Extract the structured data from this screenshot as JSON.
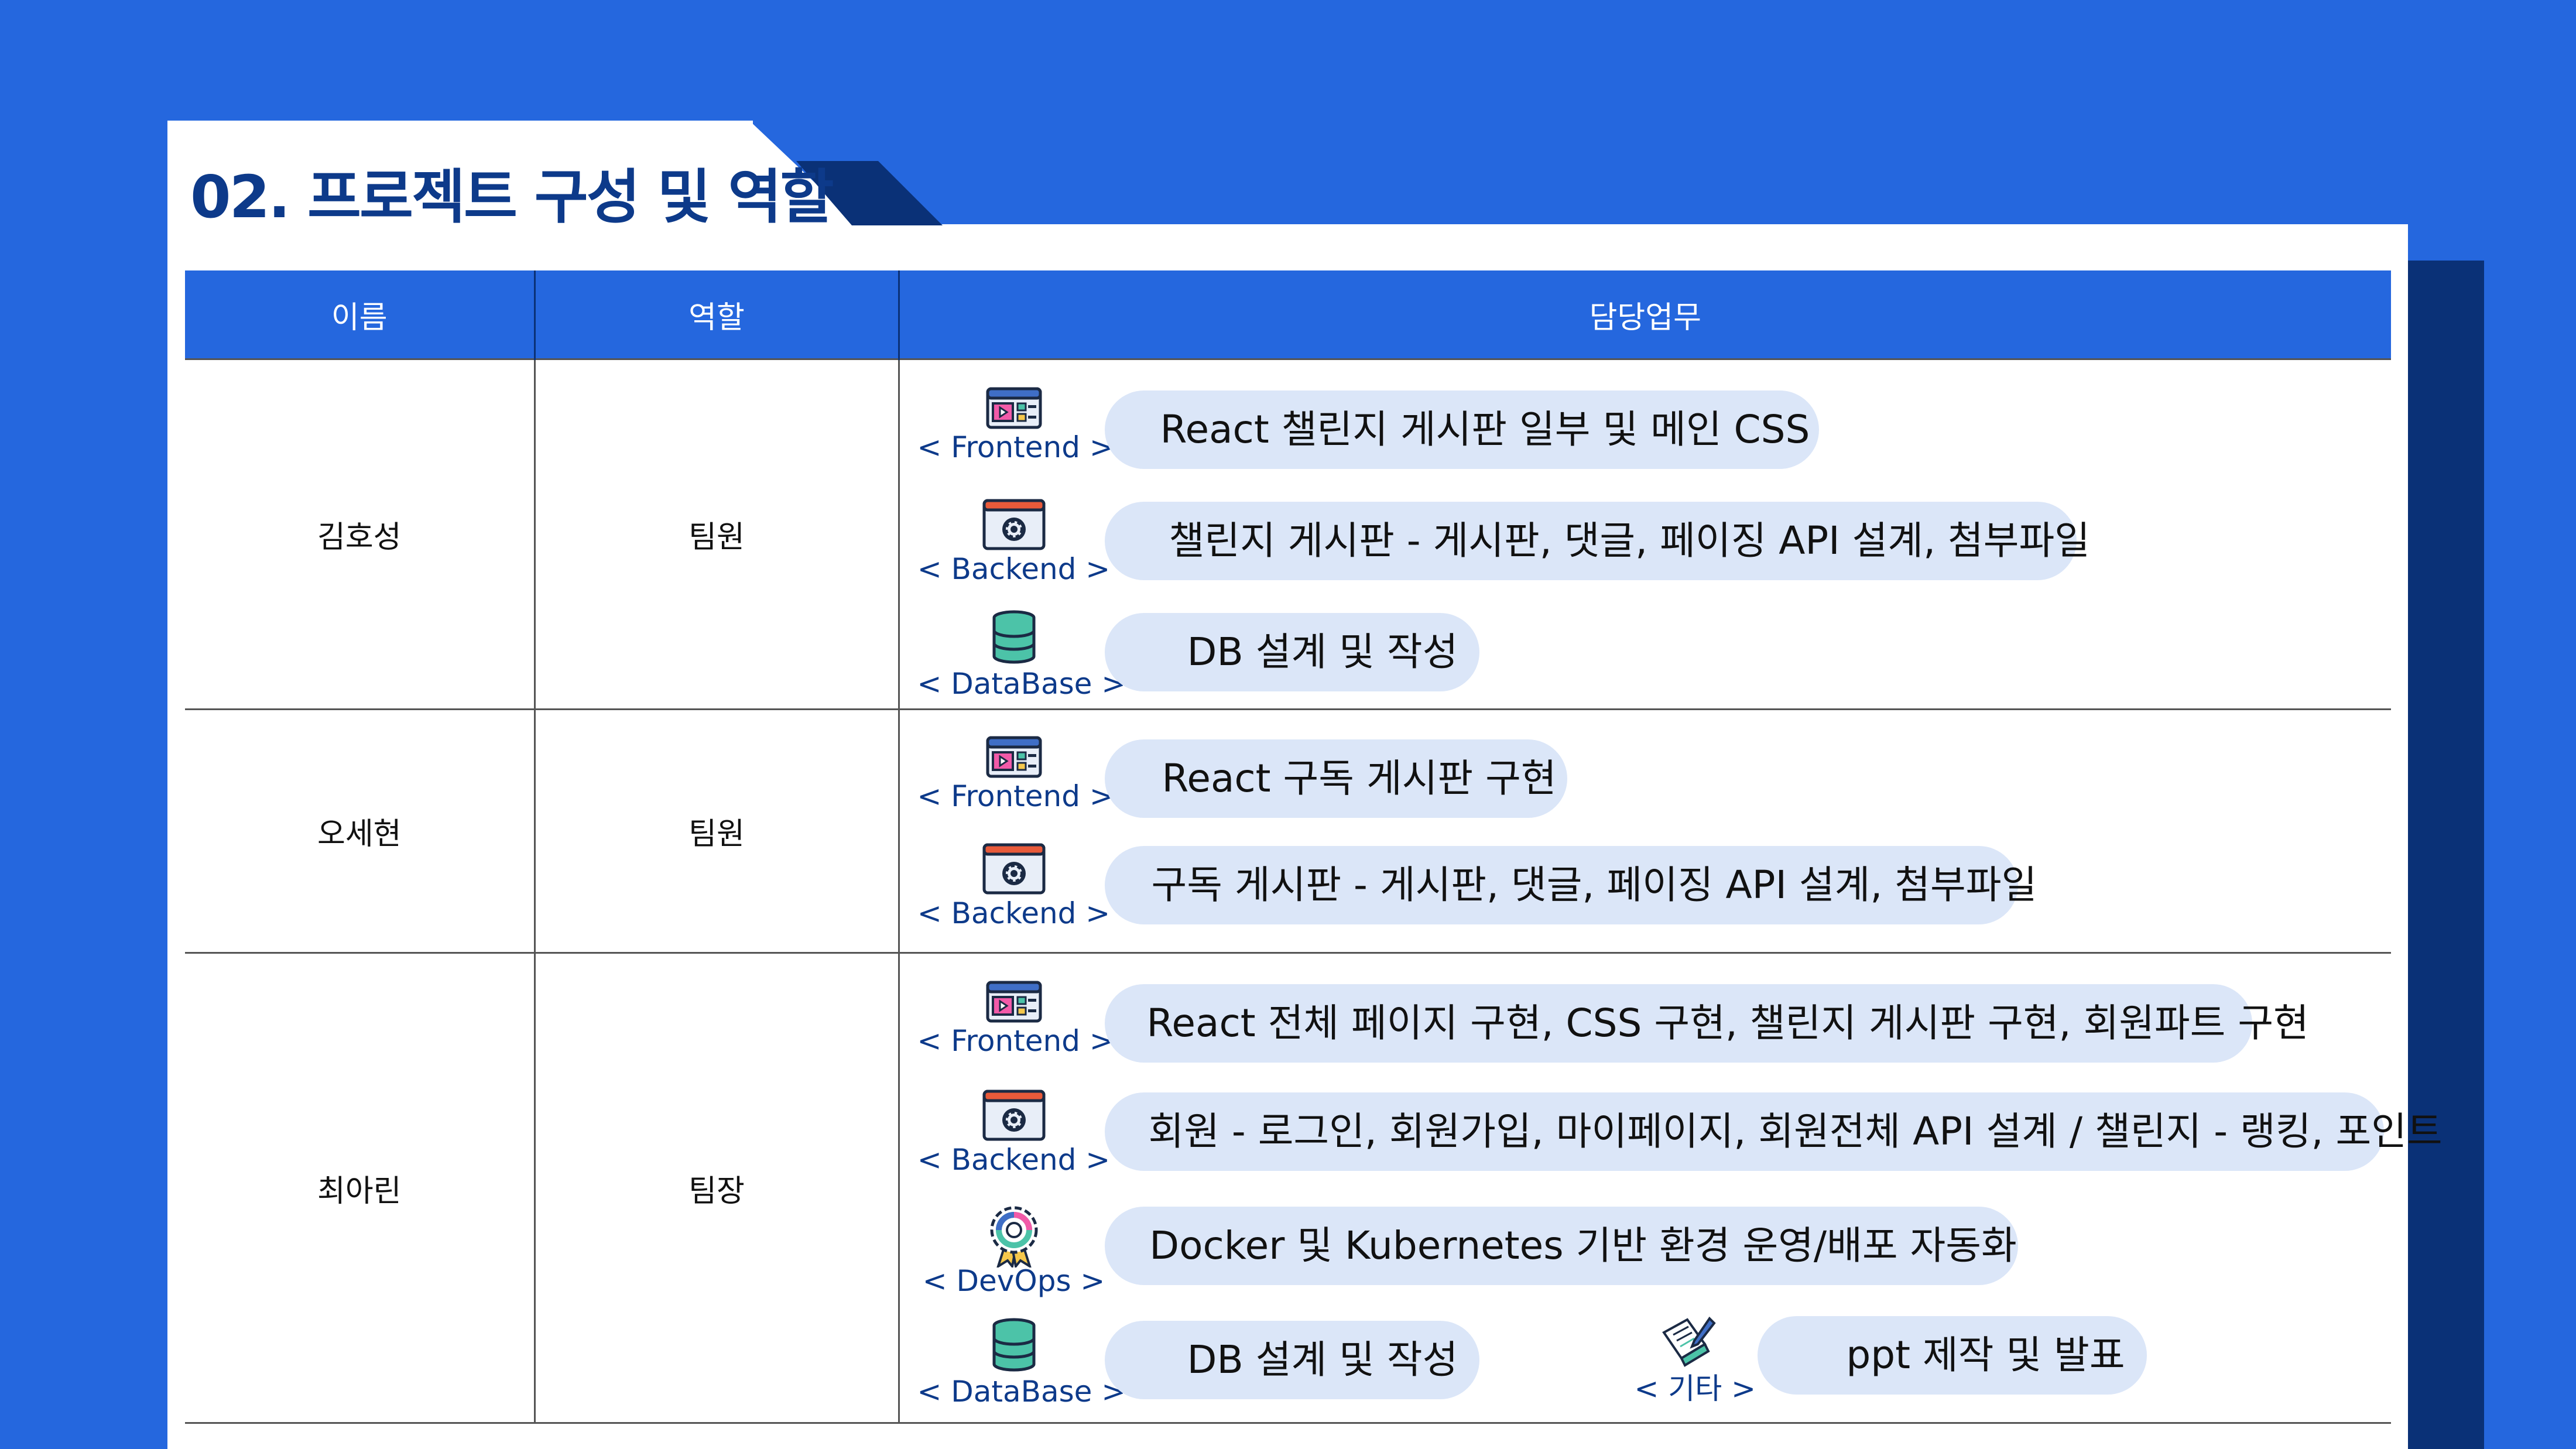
{
  "page": {
    "title": "02. 프로젝트 구성 및 역할"
  },
  "table": {
    "headers": [
      "이름",
      "역할",
      "담당업무"
    ],
    "rows": [
      {
        "name": "김호성",
        "role": "팀원",
        "tasks": [
          {
            "category": "< Frontend >",
            "icon": "frontend-window-icon",
            "text": "React 챌린지 게시판 일부 및 메인 CSS"
          },
          {
            "category": "< Backend >",
            "icon": "backend-gear-window-icon",
            "text": "챌린지 게시판 - 게시판, 댓글, 페이징 API 설계, 첨부파일"
          },
          {
            "category": "< DataBase >",
            "icon": "database-icon",
            "text": "DB 설계 및 작성"
          }
        ]
      },
      {
        "name": "오세현",
        "role": "팀원",
        "tasks": [
          {
            "category": "< Frontend >",
            "icon": "frontend-window-icon",
            "text": "React 구독 게시판 구현"
          },
          {
            "category": "< Backend >",
            "icon": "backend-gear-window-icon",
            "text": "구독 게시판 -  게시판, 댓글, 페이징 API 설계, 첨부파일"
          }
        ]
      },
      {
        "name": "최아린",
        "role": "팀장",
        "tasks": [
          {
            "category": "< Frontend >",
            "icon": "frontend-window-icon",
            "text": "React 전체 페이지 구현, CSS 구현, 챌린지 게시판 구현, 회원파트 구현"
          },
          {
            "category": "< Backend >",
            "icon": "backend-gear-window-icon",
            "text": "회원 - 로그인, 회원가입, 마이페이지, 회원전체 API 설계 / 챌린지 - 랭킹, 포인트"
          },
          {
            "category": "< DevOps >",
            "icon": "devops-gear-badge-icon",
            "text": "Docker 및 Kubernetes 기반 환경 운영/배포 자동화"
          },
          {
            "category": "< DataBase >",
            "icon": "database-icon",
            "text": "DB 설계 및 작성"
          },
          {
            "category": "< 기타 >",
            "icon": "document-pencil-icon",
            "text": "ppt 제작 및 발표"
          }
        ]
      }
    ]
  },
  "colors": {
    "background": "#2567DE",
    "accent_dark": "#0A3177",
    "title": "#0D3A8A",
    "pill": "#DBE6F8",
    "header": "#2567DE"
  }
}
